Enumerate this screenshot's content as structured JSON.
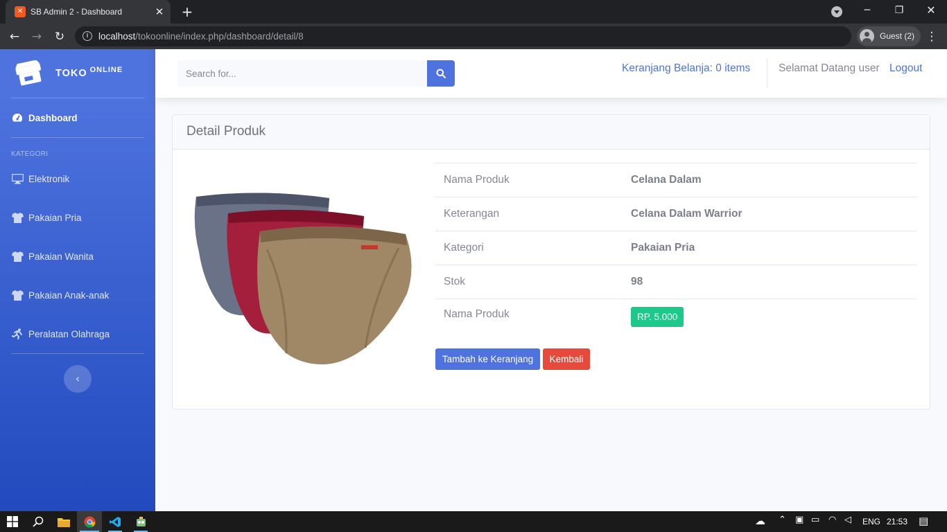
{
  "browser": {
    "tab_title": "SB Admin 2 - Dashboard",
    "tab_favicon": "xampp-icon",
    "url_host": "localhost",
    "url_path": "/tokoonline/index.php/dashboard/detail/8",
    "profile_label": "Guest (2)"
  },
  "sidebar": {
    "brand_main": "TOKO",
    "brand_sup": "ONLINE",
    "dashboard_label": "Dashboard",
    "heading": "KATEGORI",
    "items": [
      {
        "label": "Elektronik",
        "icon": "desktop-icon"
      },
      {
        "label": "Pakaian Pria",
        "icon": "tshirt-icon"
      },
      {
        "label": "Pakaian Wanita",
        "icon": "tshirt-icon"
      },
      {
        "label": "Pakaian Anak-anak",
        "icon": "tshirt-icon"
      },
      {
        "label": "Peralatan Olahraga",
        "icon": "running-icon"
      }
    ],
    "toggle_icon": "chevron-left-icon"
  },
  "topbar": {
    "search_placeholder": "Search for...",
    "cart_label": "Keranjang Belanja: 0 items",
    "welcome": "Selamat Datang user",
    "logout": "Logout"
  },
  "card": {
    "title": "Detail Produk",
    "rows": [
      {
        "label": "Nama Produk",
        "value": "Celana Dalam"
      },
      {
        "label": "Keterangan",
        "value": "Celana Dalam Warrior"
      },
      {
        "label": "Kategori",
        "value": "Pakaian Pria"
      },
      {
        "label": "Stok",
        "value": "98"
      },
      {
        "label": "Nama Produk",
        "value": "RP. 5.000"
      }
    ],
    "add_to_cart": "Tambah ke Keranjang",
    "back": "Kembali"
  },
  "colors": {
    "primary": "#4e73df",
    "success": "#1cc88a",
    "danger": "#e74a3b"
  },
  "taskbar": {
    "language": "ENG",
    "time": "21:53"
  }
}
